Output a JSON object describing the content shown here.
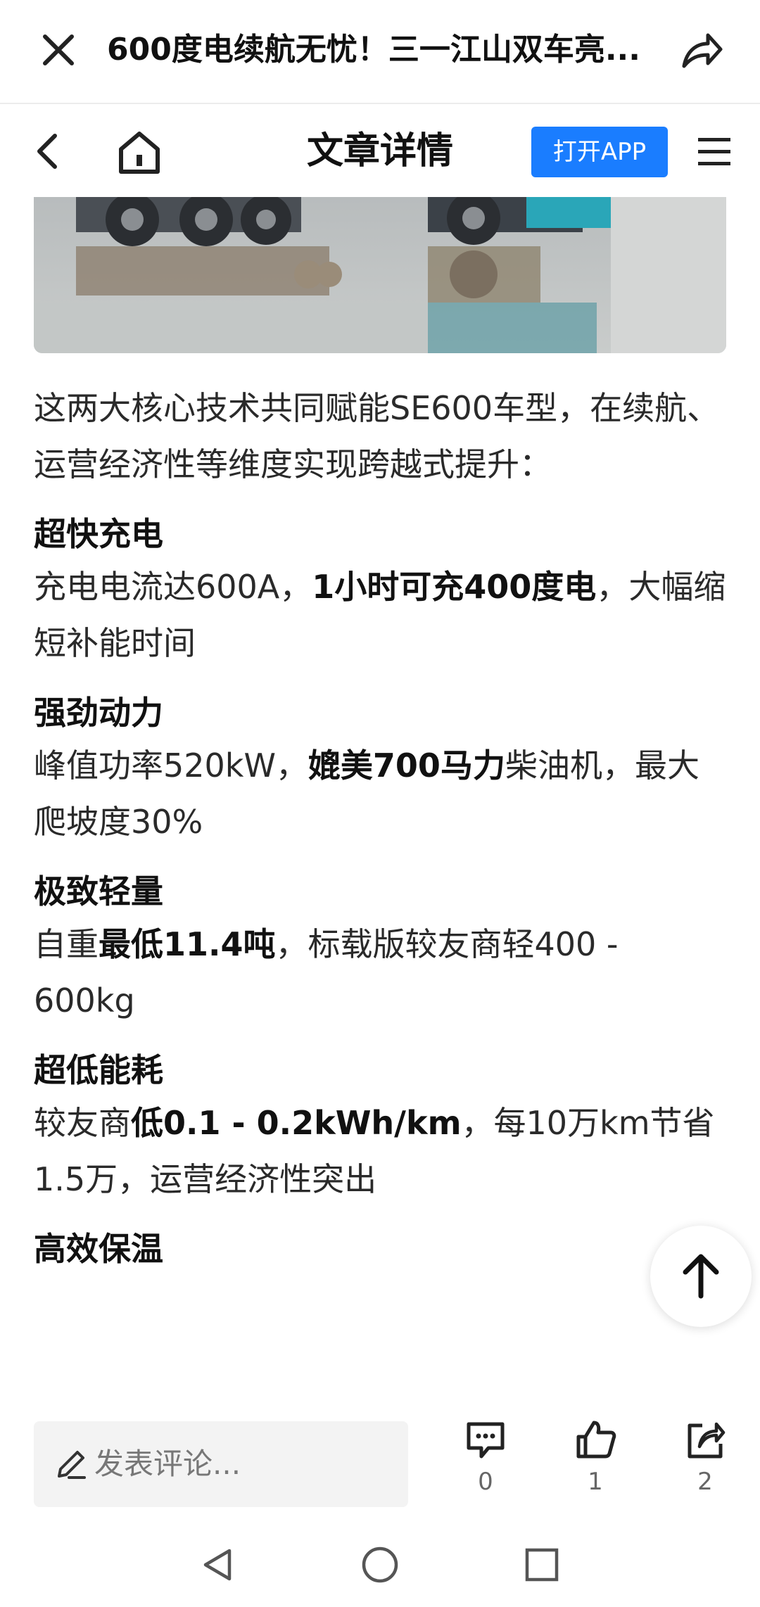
{
  "top_bar": {
    "title": "600度电续航无忧！三一江山双车亮..."
  },
  "nav_bar": {
    "page_title": "文章详情",
    "open_app_label": "打开APP"
  },
  "article": {
    "intro": "这两大核心技术共同赋能SE600车型，在续航、运营经济性等维度实现跨越式提升：",
    "sections": [
      {
        "heading": "超快充电",
        "pre": "充电电流达600A，",
        "bold": "1小时可充400度电",
        "post": "，大幅缩短补能时间"
      },
      {
        "heading": "强劲动力",
        "pre": "峰值功率520kW，",
        "bold": "媲美700马力",
        "post": "柴油机，最大爬坡度30%"
      },
      {
        "heading": "极致轻量",
        "pre": "自重",
        "bold": "最低11.4吨",
        "post": "，标载版较友商轻400 - 600kg"
      },
      {
        "heading": "超低能耗",
        "pre": "较友商",
        "bold": "低0.1 - 0.2kWh/km",
        "post": "，每10万km节省1.5万，运营经济性突出"
      },
      {
        "heading": "高效保温"
      }
    ]
  },
  "bottom_bar": {
    "comment_placeholder": "发表评论...",
    "comment_count": "0",
    "like_count": "1",
    "share_count": "2"
  },
  "colors": {
    "accent": "#1a7dff",
    "text": "#222222",
    "comment_box_bg": "#f3f3f3"
  }
}
